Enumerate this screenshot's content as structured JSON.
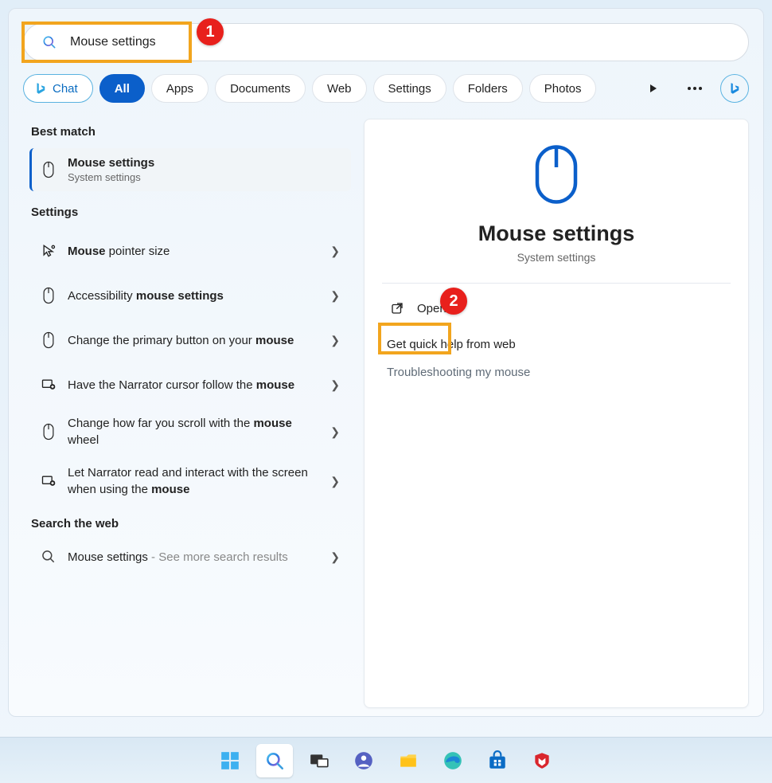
{
  "search": {
    "value": "Mouse settings"
  },
  "annotations": {
    "badge1": "1",
    "badge2": "2"
  },
  "tabs": {
    "chat": "Chat",
    "items": [
      "All",
      "Apps",
      "Documents",
      "Web",
      "Settings",
      "Folders",
      "Photos"
    ],
    "active_index": 0
  },
  "left": {
    "best_match_header": "Best match",
    "best_match": {
      "title": "Mouse settings",
      "subtitle": "System settings"
    },
    "settings_header": "Settings",
    "settings_items": [
      {
        "pre": "",
        "bold": "Mouse",
        "post": " pointer size",
        "icon": "pointer-size"
      },
      {
        "pre": "Accessibility ",
        "bold": "mouse settings",
        "post": "",
        "icon": "mouse"
      },
      {
        "pre": "Change the primary button on your ",
        "bold": "mouse",
        "post": "",
        "icon": "mouse"
      },
      {
        "pre": "Have the Narrator cursor follow the ",
        "bold": "mouse",
        "post": "",
        "icon": "narrator"
      },
      {
        "pre": "Change how far you scroll with the ",
        "bold": "mouse",
        "post": " wheel",
        "icon": "mouse"
      },
      {
        "pre": "Let Narrator read and interact with the screen when using the ",
        "bold": "mouse",
        "post": "",
        "icon": "narrator"
      }
    ],
    "web_header": "Search the web",
    "web_item": {
      "title": "Mouse settings",
      "suffix": " - See more search results"
    }
  },
  "right": {
    "title": "Mouse settings",
    "subtitle": "System settings",
    "open_label": "Open",
    "help_header": "Get quick help from web",
    "links": [
      "Troubleshooting my mouse"
    ]
  },
  "taskbar": {
    "items": [
      "start",
      "search",
      "taskview",
      "chat",
      "explorer",
      "edge",
      "store",
      "mcafee"
    ],
    "active": "search"
  }
}
